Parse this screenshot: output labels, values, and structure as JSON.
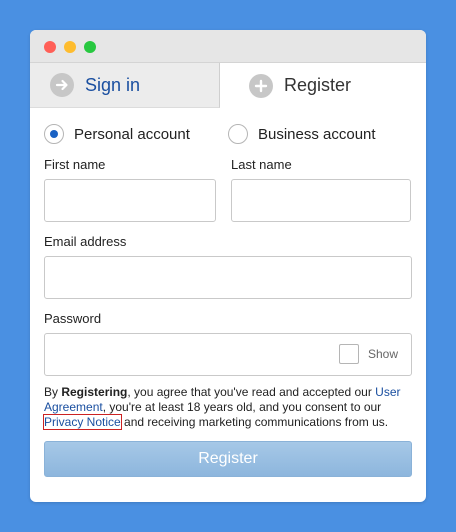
{
  "window": {
    "controls": [
      "close",
      "minimize",
      "zoom"
    ]
  },
  "tabs": [
    {
      "label": "Sign in",
      "icon": "arrow-right-circle-icon",
      "active": false
    },
    {
      "label": "Register",
      "icon": "plus-circle-icon",
      "active": true
    }
  ],
  "account_type": {
    "options": [
      {
        "label": "Personal account",
        "selected": true
      },
      {
        "label": "Business account",
        "selected": false
      }
    ]
  },
  "form": {
    "first_name": {
      "label": "First name",
      "value": "",
      "placeholder": ""
    },
    "last_name": {
      "label": "Last name",
      "value": "",
      "placeholder": ""
    },
    "email": {
      "label": "Email address",
      "value": "",
      "placeholder": ""
    },
    "password": {
      "label": "Password",
      "value": "",
      "placeholder": "",
      "show_label": "Show"
    }
  },
  "legal": {
    "prefix": "By ",
    "bold": "Registering",
    "text1": ", you agree that you've read and accepted our ",
    "link1": "User Agreement",
    "text2": ", you're at least 18 years old, and you consent to our ",
    "link2": "Privacy Notice",
    "text3": " and receiving marketing communications from us."
  },
  "submit": {
    "label": "Register"
  },
  "colors": {
    "background": "#4a90e2",
    "link": "#1a4fa0",
    "button": "#8db6dd",
    "radio_selected": "#1a62c4"
  }
}
